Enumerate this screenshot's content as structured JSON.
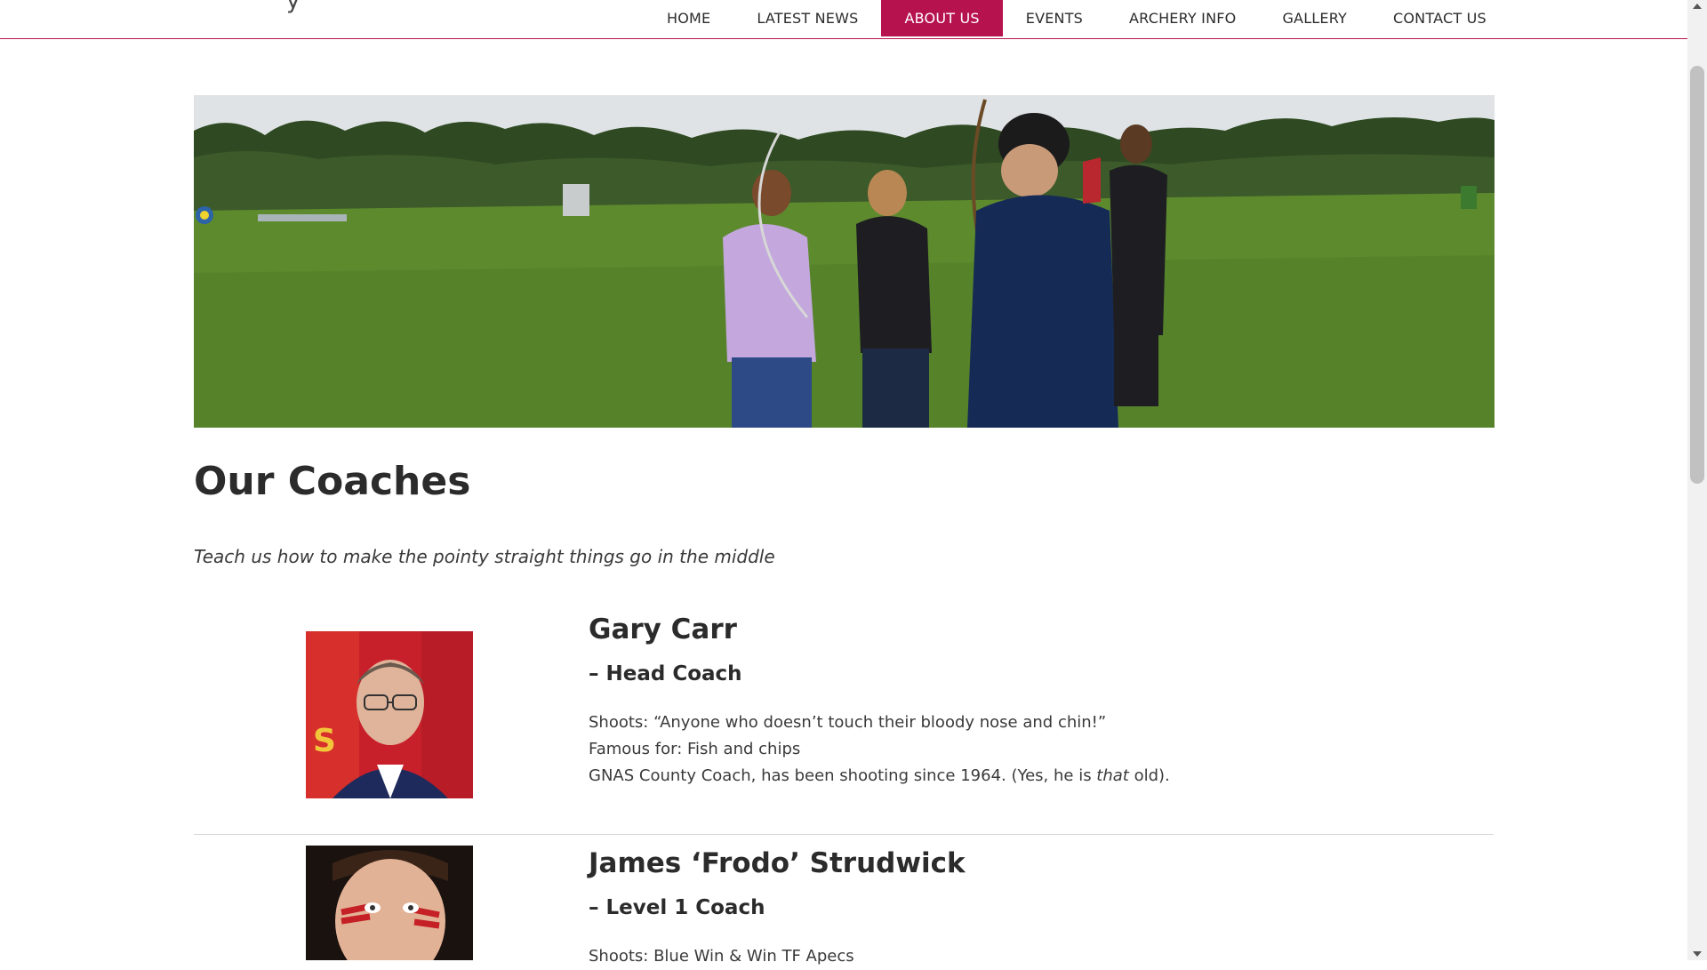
{
  "header": {
    "logo_fragment": "y",
    "nav": [
      {
        "label": "HOME",
        "active": false
      },
      {
        "label": "LATEST NEWS",
        "active": false
      },
      {
        "label": "ABOUT US",
        "active": true
      },
      {
        "label": "EVENTS",
        "active": false
      },
      {
        "label": "ARCHERY INFO",
        "active": false
      },
      {
        "label": "GALLERY",
        "active": false
      },
      {
        "label": "CONTACT US",
        "active": false
      }
    ]
  },
  "colors": {
    "accent": "#b6124e",
    "text": "#2b2b2b"
  },
  "main": {
    "title": "Our Coaches",
    "tagline": "Teach us how to make the pointy straight things go in the middle",
    "coaches": [
      {
        "name": "Gary Carr",
        "role": "– Head Coach",
        "shoots": "Shoots: “Anyone who doesn’t touch their bloody nose and chin!”",
        "famous_for": "Famous for: Fish and chips",
        "bio_prefix": "GNAS County Coach, has been shooting since 1964. (Yes, he is ",
        "bio_emphasis": "that",
        "bio_suffix": " old)."
      },
      {
        "name": "James ‘Frodo’ Strudwick",
        "role": "– Level 1 Coach",
        "shoots": "Shoots: Blue Win & Win TF Apecs"
      }
    ]
  }
}
